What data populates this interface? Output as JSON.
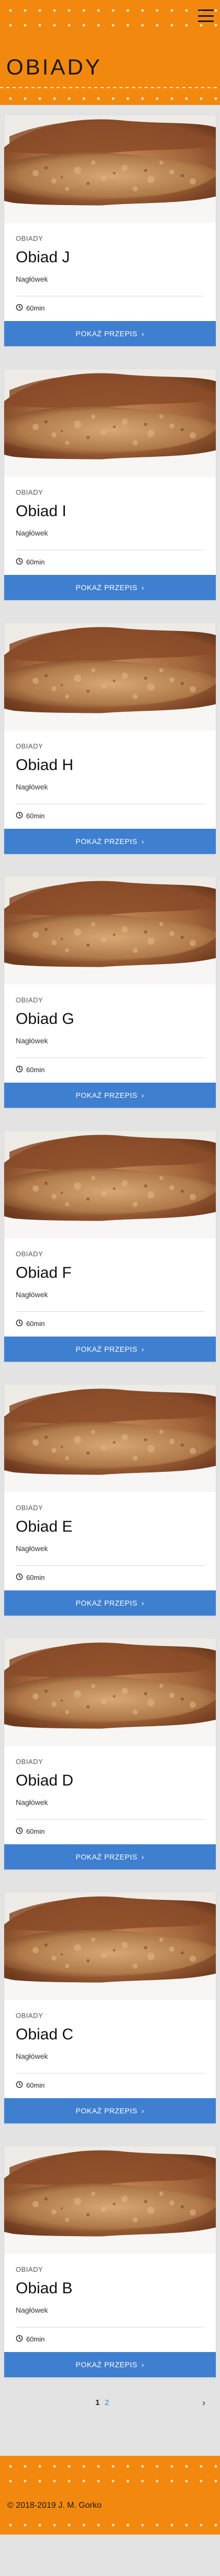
{
  "header": {
    "title": "OBIADY",
    "menu_icon": "hamburger-menu-icon",
    "brand_color": "#f2890e"
  },
  "cards": [
    {
      "category": "OBIADY",
      "title": "Obiad J",
      "subtitle": "Nagłówek",
      "time": "60min",
      "button": "POKAŻ PRZEPIS"
    },
    {
      "category": "OBIADY",
      "title": "Obiad I",
      "subtitle": "Nagłówek",
      "time": "60min",
      "button": "POKAŻ PRZEPIS"
    },
    {
      "category": "OBIADY",
      "title": "Obiad H",
      "subtitle": "Nagłówek",
      "time": "60min",
      "button": "POKAŻ PRZEPIS"
    },
    {
      "category": "OBIADY",
      "title": "Obiad G",
      "subtitle": "Nagłówek",
      "time": "60min",
      "button": "POKAŻ PRZEPIS"
    },
    {
      "category": "OBIADY",
      "title": "Obiad F",
      "subtitle": "Nagłówek",
      "time": "60min",
      "button": "POKAŻ PRZEPIS"
    },
    {
      "category": "OBIADY",
      "title": "Obiad E",
      "subtitle": "Nagłówek",
      "time": "60min",
      "button": "POKAŻ PRZEPIS"
    },
    {
      "category": "OBIADY",
      "title": "Obiad D",
      "subtitle": "Nagłówek",
      "time": "60min",
      "button": "POKAŻ PRZEPIS"
    },
    {
      "category": "OBIADY",
      "title": "Obiad C",
      "subtitle": "Nagłówek",
      "time": "60min",
      "button": "POKAŻ PRZEPIS"
    },
    {
      "category": "OBIADY",
      "title": "Obiad B",
      "subtitle": "Nagłówek",
      "time": "60min",
      "button": "POKAŻ PRZEPIS"
    }
  ],
  "pagination": {
    "pages": [
      "1",
      "2"
    ],
    "current": "1",
    "next": "›"
  },
  "footer": {
    "copyright": "© 2018-2019 J. M. Gorko"
  },
  "colors": {
    "accent": "#f2890e",
    "button": "#3f7fd0"
  }
}
